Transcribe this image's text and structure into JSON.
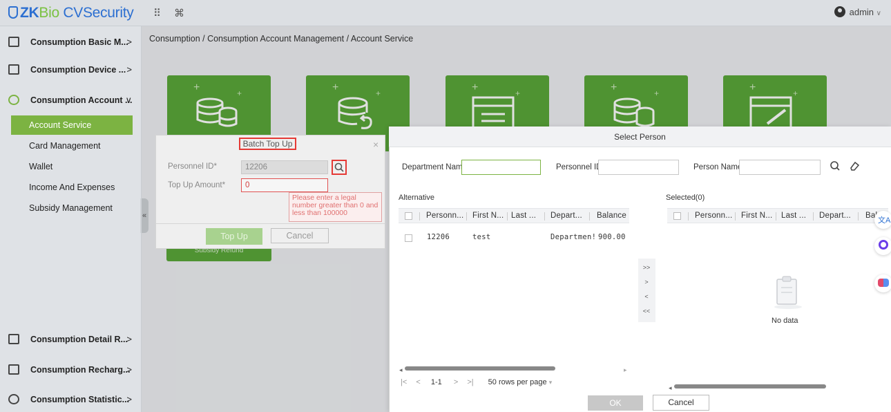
{
  "app": {
    "logo_zk": "ZK",
    "logo_bio": "Bio",
    "logo_cvs": " CVSecurity",
    "apps_icon": "grid-icon",
    "cmd_icon": "⌘",
    "user": "admin"
  },
  "sidebar": {
    "groups": [
      {
        "label": "Consumption Basic M...",
        "chevron": ">"
      },
      {
        "label": "Consumption Device ...",
        "chevron": ">"
      },
      {
        "label": "Consumption Account ...",
        "chevron": "∨"
      },
      {
        "label": "Consumption Detail R...",
        "chevron": ">"
      },
      {
        "label": "Consumption Recharg...",
        "chevron": ">"
      },
      {
        "label": "Consumption Statistic...",
        "chevron": ">"
      }
    ],
    "subitems": [
      "Account Service",
      "Card Management",
      "Wallet",
      "Income And Expenses",
      "Subsidy Management"
    ],
    "collapse": "«"
  },
  "breadcrumb": "Consumption / Consumption Account Management / Account Service",
  "tile_bottom_label": "Subsidy Refund",
  "batch_dialog": {
    "title": "Batch Top Up",
    "close": "×",
    "personnel_id_label": "Personnel ID*",
    "personnel_id_value": "12206",
    "amount_label": "Top Up Amount*",
    "amount_value": "0",
    "error": "Please enter a legal number greater than 0 and less than 100000",
    "topup_button": "Top Up",
    "cancel_button": "Cancel"
  },
  "select_person": {
    "title": "Select Person",
    "dept_label": "Department Name",
    "pid_label": "Personnel ID",
    "name_label": "Person Name",
    "alternative_label": "Alternative",
    "selected_label": "Selected(0)",
    "alt_columns": [
      "Personn...",
      "First N...",
      "Last ...",
      "Depart...",
      "Balance"
    ],
    "sel_columns": [
      "Personn...",
      "First N...",
      "Last ...",
      "Depart...",
      "Bal"
    ],
    "rows": [
      {
        "pid": "12206",
        "first": "test",
        "last": "",
        "dept": "Departmen!",
        "balance": "900.00"
      }
    ],
    "transfer": [
      ">>",
      ">",
      "<",
      "<<"
    ],
    "no_data": "No data",
    "pager": {
      "first": "|<",
      "prev": "<",
      "range": "1-1",
      "next": ">",
      "last": ">|",
      "rows_per_page": "50 rows per page"
    },
    "ok_button": "OK",
    "cancel_button": "Cancel"
  }
}
